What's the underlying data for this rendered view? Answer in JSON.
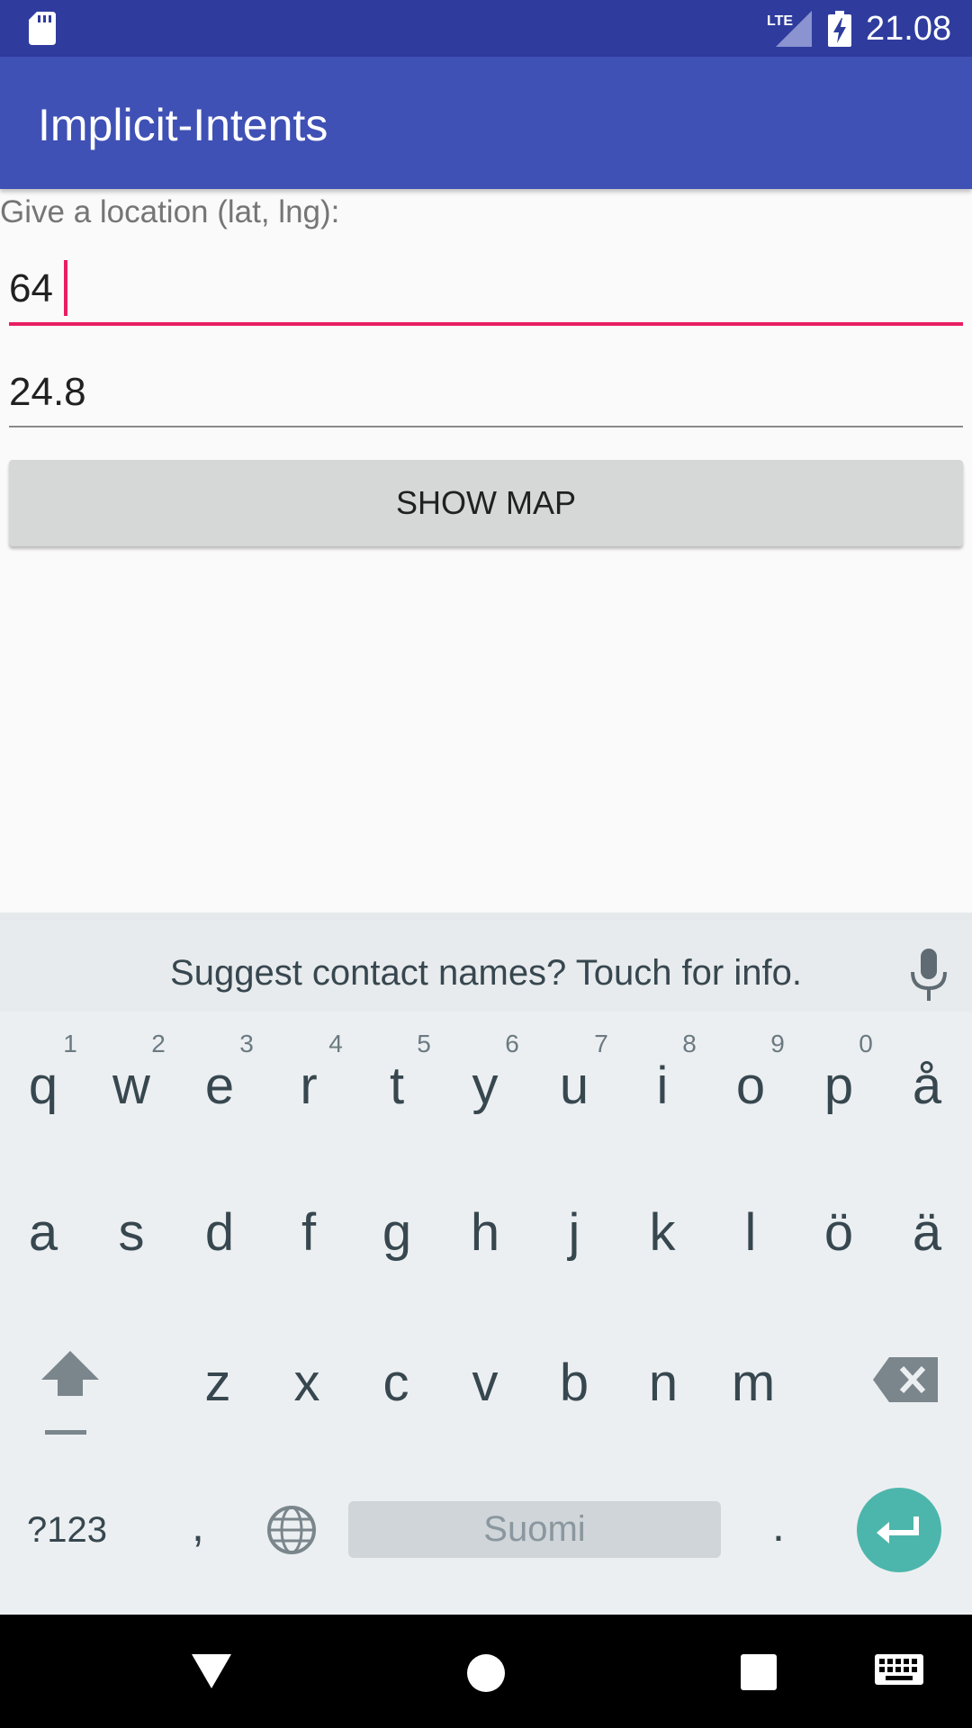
{
  "status_bar": {
    "network_label": "LTE",
    "time": "21.08"
  },
  "app_bar": {
    "title": "Implicit-Intents"
  },
  "content": {
    "prompt_label": "Give a location (lat, lng):",
    "latitude_value": "64",
    "longitude_value": "24.8",
    "show_map_label": "SHOW MAP"
  },
  "keyboard": {
    "suggestion_text": "Suggest contact names? Touch for info.",
    "row1": [
      "q",
      "w",
      "e",
      "r",
      "t",
      "y",
      "u",
      "i",
      "o",
      "p",
      "å"
    ],
    "row1_hints": [
      "1",
      "2",
      "3",
      "4",
      "5",
      "6",
      "7",
      "8",
      "9",
      "0"
    ],
    "row2": [
      "a",
      "s",
      "d",
      "f",
      "g",
      "h",
      "j",
      "k",
      "l",
      "ö",
      "ä"
    ],
    "row3": [
      "z",
      "x",
      "c",
      "v",
      "b",
      "n",
      "m"
    ],
    "symbols_label": "?123",
    "comma_label": ",",
    "space_label": "Suomi",
    "period_label": ".",
    "accent_color": "#4db6ac"
  },
  "colors": {
    "status_bar": "#2f3c9e",
    "app_bar": "#3f51b5",
    "focus_accent": "#e91e63"
  },
  "icons": [
    "sd-card-icon",
    "lte-signal-icon",
    "battery-charging-icon",
    "mic-icon",
    "shift-icon",
    "backspace-icon",
    "globe-icon",
    "enter-icon",
    "back-icon",
    "home-icon",
    "recents-icon",
    "keyboard-icon"
  ]
}
